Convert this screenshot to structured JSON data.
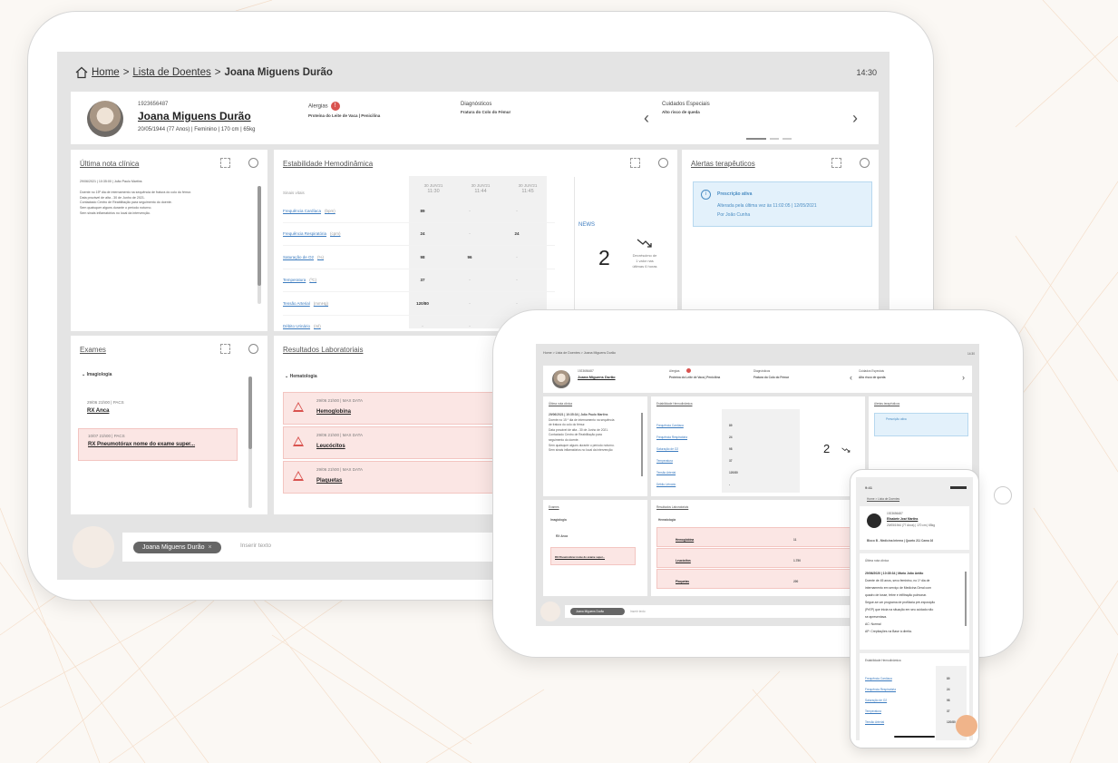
{
  "desktop": {
    "breadcrumb": {
      "home": "Home",
      "sep1": ">",
      "list": "Lista de Doentes",
      "sep2": ">",
      "current": "Joana Miguens Durão"
    },
    "clock": "14:30",
    "patient": {
      "id": "1923656487",
      "name": "Joana Miguens Durão",
      "info": "20/05/1944 (77 Anos) | Feminino | 170 cm | 65kg"
    },
    "allergies": {
      "label": "Alergias",
      "count": "!",
      "value": "Proteína do Leite de Vaca | Penicilina"
    },
    "diagnoses": {
      "label": "Diagnósticos",
      "value": "Fratura do Colo do Fémur"
    },
    "special_care": {
      "label": "Cuidados Especiais",
      "value": "Alto risco de queda"
    },
    "last_note": {
      "title": "Última nota clínica",
      "lines": [
        "29/06/2021 | 10:35:00 | João Paulo Martins",
        "Doente no 15º dia de internamento na sequência de fratura do colo do fémur.",
        "Data provável de alta - 30 de Junho de 2021.",
        "Contactado Centro de Reabilitação para seguimento do doente.",
        "Sem quaisquer alguns durante o período noturno.",
        "Sem sinais inflamatórios no local da intervenção."
      ]
    },
    "hemo": {
      "title": "Estabilidade Hemodinâmica",
      "header_label": "Sinais vitais",
      "cols": [
        {
          "date": "30 JUN'21",
          "time": "11:30"
        },
        {
          "date": "30 JUN'21",
          "time": "11:44"
        },
        {
          "date": "30 JUN'21",
          "time": "11:45"
        }
      ],
      "rows": [
        {
          "label": "Frequência Cardíaca",
          "unit": "(bpm)",
          "v": [
            "89",
            "-",
            "-"
          ]
        },
        {
          "label": "Frequência Respiratória",
          "unit": "(cpm)",
          "v": [
            "24",
            "-",
            "24"
          ]
        },
        {
          "label": "Saturação de O2",
          "unit": "(%)",
          "v": [
            "98",
            "96",
            "-"
          ]
        },
        {
          "label": "Temperatura",
          "unit": "(ºC)",
          "v": [
            "37",
            "-",
            "-"
          ]
        },
        {
          "label": "Tensão Arterial",
          "unit": "(mmHg)",
          "v": [
            "120/80",
            "-",
            "-"
          ]
        },
        {
          "label": "Débito Urinário",
          "unit": "(ml)",
          "v": [
            "-",
            "-",
            "-"
          ]
        }
      ],
      "news_label": "NEWS",
      "news_value": "2",
      "news_trend": [
        "Decréscimo de",
        "1 valor nas",
        "últimas 6 horas"
      ]
    },
    "alerts": {
      "title": "Alertas terapêuticos",
      "box_title": "Prescrição ativa",
      "line1": "Alterada pela última vez às 11:02:05 | 12/05/2021",
      "line2": "Por João Cunha"
    },
    "exams": {
      "title": "Exames",
      "group": "Imagiologia",
      "items": [
        {
          "date": "29/06 21h00 | PACS",
          "name": "RX Anca",
          "alert": false
        },
        {
          "date": "10/07 21h00 | PACS",
          "name": "RX Pneumotórax nome do exame super...",
          "alert": true
        }
      ]
    },
    "labs": {
      "title": "Resultados Laboratoriais",
      "group": "Hematologia",
      "items": [
        {
          "date": "29/06 21h00 | MAX DATA",
          "name": "Hemoglobina"
        },
        {
          "date": "29/06 21h00 | MAX DATA",
          "name": "Leucócitos"
        },
        {
          "date": "29/06 21h00 | MAX DATA",
          "name": "Plaquetas"
        }
      ]
    },
    "composer": {
      "chip": "Joana Miguens Durão",
      "chip_close": "×",
      "placeholder": "Inserir texto"
    }
  },
  "tablet": {
    "breadcrumb": "Home > Lista de Doentes > Joana Miguens Durão",
    "clock": "14:30",
    "patient_name": "Joana Miguens Durão",
    "patient_id": "1923656487",
    "allergies": "Alergias",
    "allergies_value": "Proteína do Leite de Vaca | Penicilina",
    "diagnoses": "Diagnósticos",
    "diagnoses_value": "Fratura do Colo do Fémur",
    "special_care": "Cuidados Especiais",
    "special_care_value": "Alto risco de queda",
    "note_title": "Última nota clínica",
    "note_lines": [
      "29/06/2021 | 10:35:34 | João Paulo Martins",
      "Doente no 15 º dia de internamento na sequência",
      "de fratura do colo do fémur.",
      "Data provável de alta - 30 de Junho de 2021.",
      "Contactado Centro de Reabilitação para",
      "seguimento do doente.",
      "Sem quaisquer alguns durante o período noturno.",
      "Sem sinais inflamatórios no local da intervenção"
    ],
    "hemo_title": "Estabilidade Hemodinâmica",
    "hemo_rows": [
      "Frequência Cardíaca",
      "Frequência Respiratória",
      "Saturação de O2",
      "Temperatura",
      "Tensão Arterial",
      "Débito Urinário"
    ],
    "hemo_vals": [
      "89",
      "24",
      "98",
      "37",
      "120/80",
      "-"
    ],
    "news_value": "2",
    "alerts_title": "Alertas terapêuticos",
    "alerts_box": "Prescrição ativa",
    "exams_title": "Exames",
    "exams_group": "Imagiologia",
    "exam_items": [
      "RX Anca",
      "RX Pneumotórax nome do exame super..."
    ],
    "labs_title": "Resultados Laboratoriais",
    "labs_group": "Hematologia",
    "lab_items": [
      "Hemoglobina",
      "Leucócitos",
      "Plaquetas"
    ],
    "lab_vals": [
      "11",
      "1.750",
      "200"
    ],
    "chip": "Joana Miguens Durão",
    "placeholder": "Inserir texto"
  },
  "phone": {
    "time": "9:41",
    "breadcrumb": "Home > Lista de Doentes",
    "patient_id": "1923656487",
    "patient_name": "Elisabete José Martins",
    "patient_info": "20/05/1944 (77 Anos) | 170 cm | 65kg",
    "location": "Bloco B - Medicina Interna | Quarto 211 Cama 16",
    "note_title": "Última nota clínica",
    "note_lines": [
      "29/06/2020 | 10:35:34 | Maria João Antão",
      "Doente de 45 anos, sexo feminino, no 1º dia de",
      "internamento em serviço de Medicina Geral com",
      "quadro de tosse, febre e infiltração pulmonar.",
      "Segue-se um programa de profilaxia pré-exposição",
      "(PrEP) que inicia na situação em seu cuidado não",
      "se apresentava.",
      "AC: Normal",
      "AP: Crepitações na Base à direita."
    ],
    "hemo_title": "Estabilidade Hemodinâmica",
    "hemo_rows": [
      "Frequência Cardíaca",
      "Frequência Respiratória",
      "Saturação de O2",
      "Temperatura",
      "Tensão Arterial"
    ],
    "hemo_vals": [
      "89",
      "24",
      "98",
      "37",
      "120/80"
    ]
  },
  "colors": {
    "accent": "#3b7bbf",
    "alert": "#d9534f",
    "alert_bg": "#fbe6e4",
    "info_bg": "#e3f1fb"
  }
}
